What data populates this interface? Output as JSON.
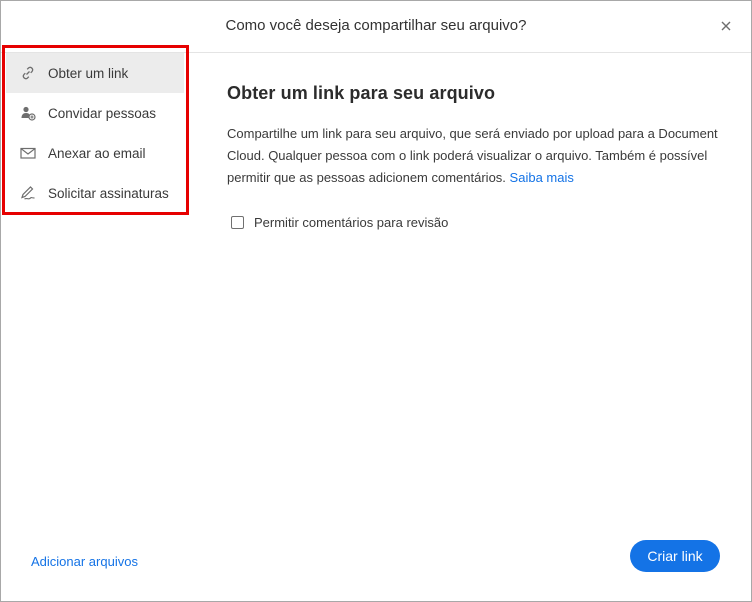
{
  "header": {
    "title": "Como você deseja compartilhar seu arquivo?",
    "close_icon": "close-icon"
  },
  "sidebar": {
    "items": [
      {
        "label": "Obter um link",
        "icon": "link-icon",
        "active": true
      },
      {
        "label": "Convidar pessoas",
        "icon": "add-person-icon",
        "active": false
      },
      {
        "label": "Anexar ao email",
        "icon": "envelope-icon",
        "active": false
      },
      {
        "label": "Solicitar assinaturas",
        "icon": "signature-icon",
        "active": false
      }
    ]
  },
  "content": {
    "heading": "Obter um link para seu arquivo",
    "description": "Compartilhe um link para seu arquivo, que será enviado por upload para a Document Cloud. Qualquer pessoa com o link poderá visualizar o arquivo. Também é possível permitir que as pessoas adicionem comentários.",
    "learn_more": "Saiba mais",
    "checkbox_label": "Permitir comentários para revisão",
    "checkbox_checked": false
  },
  "footer": {
    "add_files": "Adicionar arquivos",
    "create_link": "Criar link"
  },
  "colors": {
    "accent": "#1473e6",
    "highlight": "#e60000",
    "active_item_bg": "#ececec"
  }
}
